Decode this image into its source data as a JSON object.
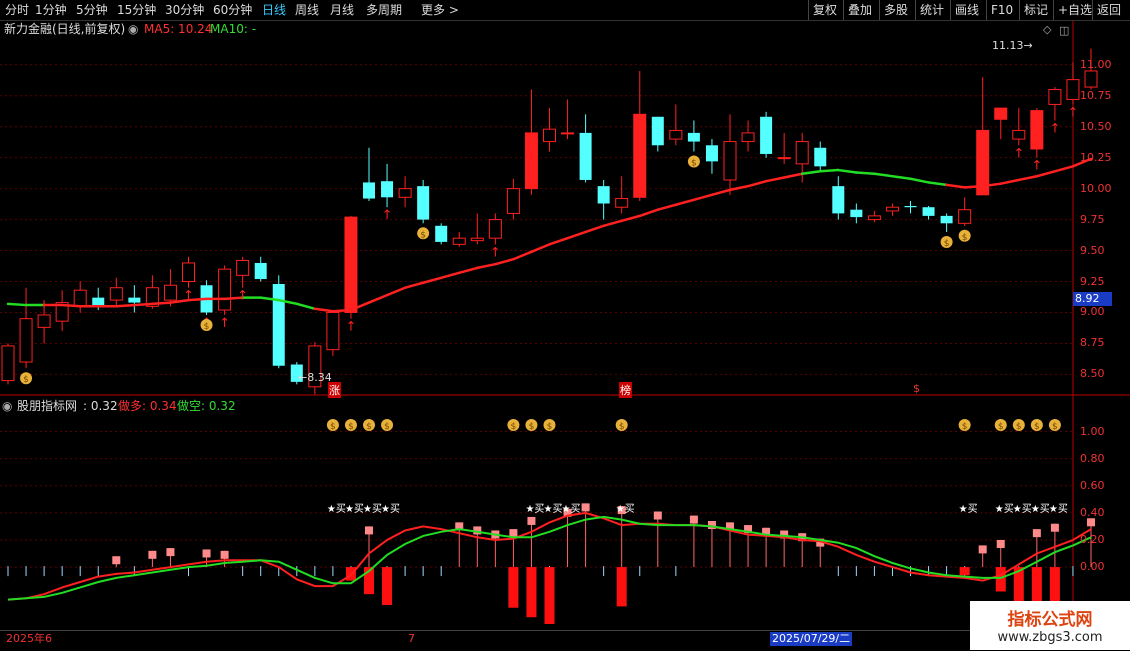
{
  "toolbar": {
    "left_items": [
      "分时",
      "1分钟",
      "5分钟",
      "15分钟",
      "30分钟",
      "60分钟",
      "日线",
      "周线",
      "月线",
      "多周期",
      "更多 >"
    ],
    "active": "日线",
    "right_items": [
      "复权",
      "叠加",
      "多股",
      "统计",
      "画线",
      "F10",
      "标记",
      "+自选",
      "返回"
    ]
  },
  "main_header": {
    "stock": "新力金融(日线,前复权)",
    "ma5_label": "MA5: 10.24",
    "ma10_label": "MA10: -"
  },
  "price_axis": {
    "ticks": [
      "11.00",
      "10.75",
      "10.50",
      "10.25",
      "10.00",
      "9.75",
      "9.50",
      "9.25",
      "9.00",
      "8.75",
      "8.50"
    ],
    "current": "8.92",
    "min": 8.35,
    "max": 11.2
  },
  "annotations": {
    "high_label": "11.13",
    "low_label": "8.34",
    "zhang": "涨",
    "bang": "榜",
    "dollar": "$",
    "buy": "买"
  },
  "indicator_header": {
    "name": "股朋指标网",
    "value": ": 0.32",
    "zuoduo": "做多: 0.34",
    "zuokong": "做空: 0.32"
  },
  "indicator_axis": {
    "ticks": [
      "1.00",
      "0.80",
      "0.60",
      "0.40",
      "0.20",
      "0.00"
    ],
    "min": -0.42,
    "max": 1.1
  },
  "dates": {
    "d1": "2025年6",
    "d2": "7",
    "d3": "2025/07/29/二"
  },
  "watermark": {
    "title": "指标公式网",
    "url": "www.zbgs3.com"
  },
  "colors": {
    "up": "#ff2020",
    "down": "#54ffff",
    "ma_green": "#22dd22",
    "ma_red": "#ff2020",
    "axis": "#e33"
  },
  "chart_data": {
    "type": "candlestick",
    "candles": [
      [
        8.45,
        8.73,
        8.75,
        8.42,
        0
      ],
      [
        8.6,
        8.95,
        9.2,
        8.55,
        0
      ],
      [
        8.88,
        8.98,
        9.1,
        8.75,
        0
      ],
      [
        8.93,
        9.08,
        9.18,
        8.85,
        0
      ],
      [
        9.05,
        9.18,
        9.25,
        9.0,
        0
      ],
      [
        9.12,
        9.06,
        9.2,
        9.02,
        0
      ],
      [
        9.1,
        9.2,
        9.28,
        9.05,
        0
      ],
      [
        9.12,
        9.08,
        9.22,
        9.0,
        0
      ],
      [
        9.05,
        9.2,
        9.3,
        9.03,
        0
      ],
      [
        9.1,
        9.22,
        9.35,
        9.05,
        0
      ],
      [
        9.25,
        9.4,
        9.45,
        9.2,
        0
      ],
      [
        9.22,
        9.0,
        9.26,
        8.98,
        0
      ],
      [
        9.02,
        9.35,
        9.38,
        8.98,
        0
      ],
      [
        9.3,
        9.42,
        9.45,
        9.2,
        0
      ],
      [
        9.4,
        9.27,
        9.45,
        9.25,
        0
      ],
      [
        9.23,
        8.57,
        9.3,
        8.55,
        0
      ],
      [
        8.58,
        8.44,
        8.6,
        8.42,
        0
      ],
      [
        8.4,
        8.73,
        8.76,
        8.34,
        0
      ],
      [
        8.7,
        9.0,
        9.02,
        8.65,
        0
      ],
      [
        9.0,
        9.77,
        9.78,
        8.95,
        0
      ],
      [
        10.05,
        9.92,
        10.33,
        9.9,
        1
      ],
      [
        10.06,
        9.93,
        10.2,
        9.85,
        1
      ],
      [
        9.93,
        10.0,
        10.1,
        9.85,
        1
      ],
      [
        10.02,
        9.75,
        10.07,
        9.72,
        0
      ],
      [
        9.7,
        9.57,
        9.72,
        9.55,
        0
      ],
      [
        9.55,
        9.6,
        9.65,
        9.53,
        0
      ],
      [
        9.58,
        9.6,
        9.8,
        9.55,
        0
      ],
      [
        9.6,
        9.75,
        9.8,
        9.55,
        0
      ],
      [
        9.8,
        10.0,
        10.08,
        9.75,
        0
      ],
      [
        10.0,
        10.45,
        10.8,
        9.95,
        0
      ],
      [
        10.38,
        10.48,
        10.65,
        10.3,
        0
      ],
      [
        10.45,
        10.45,
        10.72,
        10.4,
        0
      ],
      [
        10.45,
        10.07,
        10.6,
        10.05,
        0
      ],
      [
        10.02,
        9.88,
        10.07,
        9.75,
        0
      ],
      [
        9.85,
        9.92,
        10.1,
        9.8,
        0
      ],
      [
        9.93,
        10.6,
        10.95,
        9.9,
        0
      ],
      [
        10.58,
        10.35,
        10.58,
        10.3,
        0
      ],
      [
        10.4,
        10.47,
        10.68,
        10.35,
        0
      ],
      [
        10.45,
        10.38,
        10.55,
        10.3,
        0
      ],
      [
        10.35,
        10.22,
        10.4,
        10.12,
        0
      ],
      [
        10.07,
        10.38,
        10.6,
        9.95,
        0
      ],
      [
        10.38,
        10.45,
        10.55,
        10.3,
        0
      ],
      [
        10.58,
        10.28,
        10.62,
        10.25,
        0
      ],
      [
        10.25,
        10.25,
        10.45,
        10.2,
        0
      ],
      [
        10.2,
        10.38,
        10.45,
        10.05,
        0
      ],
      [
        10.33,
        10.18,
        10.38,
        10.15,
        0
      ],
      [
        10.02,
        9.8,
        10.1,
        9.75,
        0
      ],
      [
        9.83,
        9.77,
        9.88,
        9.72,
        0
      ],
      [
        9.75,
        9.78,
        9.82,
        9.73,
        0
      ],
      [
        9.82,
        9.85,
        9.88,
        9.78,
        0
      ],
      [
        9.86,
        9.85,
        9.9,
        9.8,
        0
      ],
      [
        9.85,
        9.78,
        9.86,
        9.75,
        0
      ],
      [
        9.78,
        9.72,
        9.8,
        9.65,
        0
      ],
      [
        9.72,
        9.83,
        9.93,
        9.7,
        0
      ],
      [
        9.95,
        10.47,
        10.9,
        9.95,
        0
      ],
      [
        10.56,
        10.65,
        10.65,
        10.4,
        0
      ],
      [
        10.4,
        10.47,
        10.65,
        10.35,
        0
      ],
      [
        10.32,
        10.63,
        10.65,
        10.25,
        0
      ],
      [
        10.68,
        10.8,
        10.82,
        10.55,
        0
      ],
      [
        10.72,
        10.88,
        11.02,
        10.68,
        0
      ],
      [
        10.82,
        10.95,
        11.13,
        10.8,
        0
      ]
    ],
    "ma_line": [
      9.07,
      9.06,
      9.06,
      9.06,
      9.05,
      9.05,
      9.05,
      9.06,
      9.07,
      9.08,
      9.1,
      9.11,
      9.11,
      9.12,
      9.12,
      9.1,
      9.07,
      9.03,
      9.01,
      9.02,
      9.08,
      9.14,
      9.2,
      9.24,
      9.28,
      9.32,
      9.36,
      9.39,
      9.43,
      9.49,
      9.55,
      9.6,
      9.65,
      9.7,
      9.74,
      9.78,
      9.83,
      9.87,
      9.91,
      9.95,
      9.99,
      10.02,
      10.06,
      10.09,
      10.12,
      10.14,
      10.15,
      10.13,
      10.12,
      10.1,
      10.08,
      10.05,
      10.03,
      10.01,
      10.02,
      10.04,
      10.07,
      10.1,
      10.14,
      10.18,
      10.24
    ],
    "ma_green_ranges": [
      [
        0,
        2
      ],
      [
        13,
        17
      ],
      [
        44,
        52
      ]
    ],
    "arrow_bars": [
      10,
      11,
      12,
      13,
      19,
      21,
      27,
      56,
      57,
      58,
      59
    ],
    "money_bars_main": [
      1,
      11,
      23,
      38,
      52,
      53
    ],
    "indicator": {
      "line_a": [
        -0.24,
        -0.23,
        -0.2,
        -0.15,
        -0.11,
        -0.07,
        -0.05,
        -0.04,
        -0.02,
        0.0,
        0.02,
        0.04,
        0.05,
        0.05,
        0.05,
        0.0,
        -0.09,
        -0.14,
        -0.14,
        -0.06,
        0.1,
        0.2,
        0.27,
        0.3,
        0.28,
        0.25,
        0.22,
        0.2,
        0.21,
        0.26,
        0.33,
        0.38,
        0.4,
        0.36,
        0.31,
        0.32,
        0.32,
        0.31,
        0.31,
        0.3,
        0.27,
        0.24,
        0.23,
        0.22,
        0.2,
        0.19,
        0.15,
        0.09,
        0.04,
        0.0,
        -0.04,
        -0.06,
        -0.07,
        -0.08,
        -0.1,
        -0.06,
        0.02,
        0.1,
        0.15,
        0.2,
        0.28
      ],
      "line_b": [
        -0.24,
        -0.23,
        -0.22,
        -0.19,
        -0.15,
        -0.11,
        -0.08,
        -0.06,
        -0.04,
        -0.02,
        0.0,
        0.01,
        0.03,
        0.04,
        0.05,
        0.04,
        -0.02,
        -0.08,
        -0.12,
        -0.12,
        -0.03,
        0.09,
        0.17,
        0.23,
        0.26,
        0.28,
        0.26,
        0.24,
        0.22,
        0.22,
        0.26,
        0.31,
        0.35,
        0.37,
        0.35,
        0.32,
        0.31,
        0.31,
        0.31,
        0.3,
        0.28,
        0.26,
        0.24,
        0.23,
        0.22,
        0.2,
        0.18,
        0.14,
        0.08,
        0.03,
        -0.01,
        -0.04,
        -0.06,
        -0.07,
        -0.08,
        -0.08,
        -0.03,
        0.04,
        0.11,
        0.16,
        0.22
      ],
      "bars": [
        0.0,
        0.0,
        0.0,
        0.0,
        0.0,
        0.0,
        0.08,
        0.0,
        0.12,
        0.14,
        0.0,
        0.13,
        0.12,
        0.0,
        0.0,
        0.0,
        0.0,
        0.0,
        0.0,
        0.0,
        0.3,
        -0.12,
        -0.24,
        -0.31,
        0.0,
        0.33,
        0.3,
        0.27,
        0.28,
        0.37,
        -0.3,
        0.43,
        0.47,
        -0.4,
        0.45,
        0.0,
        0.41,
        -0.29,
        0.38,
        0.34,
        0.33,
        0.31,
        0.29,
        0.27,
        0.25,
        0.21,
        0.0,
        0.0,
        0.0,
        0.0,
        0.0,
        0.0,
        0.0,
        0.0,
        0.16,
        0.2,
        -0.06,
        0.28,
        0.32,
        -0.17,
        0.36
      ],
      "neg_bars": [
        [
          19,
          -0.1
        ],
        [
          20,
          -0.2
        ],
        [
          21,
          -0.28
        ],
        [
          28,
          -0.3
        ],
        [
          29,
          -0.37
        ],
        [
          30,
          -0.42
        ],
        [
          34,
          -0.29
        ],
        [
          53,
          -0.06
        ],
        [
          55,
          -0.18
        ],
        [
          56,
          -0.25
        ],
        [
          57,
          -0.29
        ],
        [
          58,
          -0.3
        ]
      ],
      "money_bars": [
        18,
        19,
        20,
        21,
        28,
        29,
        30,
        34,
        53,
        55,
        56,
        57,
        58
      ],
      "buy_bars": [
        18,
        19,
        20,
        21,
        29,
        30,
        31,
        34,
        53,
        55,
        56,
        57,
        58
      ]
    }
  }
}
